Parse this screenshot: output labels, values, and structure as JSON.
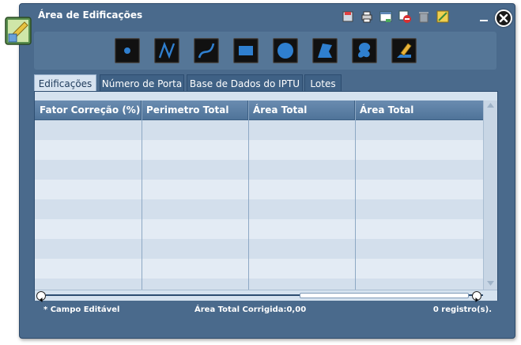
{
  "window": {
    "title": "Área de Edificações",
    "toolbar_icons": [
      "save-icon",
      "print-icon",
      "export-table-icon",
      "remove-layer-icon",
      "trash-icon",
      "measure-icon"
    ]
  },
  "draw_tools": [
    {
      "name": "point-tool",
      "icon": "point-icon"
    },
    {
      "name": "polyline-tool",
      "icon": "polyline-icon"
    },
    {
      "name": "curve-tool",
      "icon": "curve-icon"
    },
    {
      "name": "rectangle-tool",
      "icon": "rectangle-icon"
    },
    {
      "name": "circle-tool",
      "icon": "circle-icon"
    },
    {
      "name": "polygon-tool",
      "icon": "polygon-icon"
    },
    {
      "name": "freehand-polygon-tool",
      "icon": "freehand-shape-icon"
    },
    {
      "name": "edit-tool",
      "icon": "pencil-icon"
    }
  ],
  "tabs": [
    {
      "label": "Edificações",
      "active": true
    },
    {
      "label": "Número de Porta",
      "active": false
    },
    {
      "label": "Base de Dados do IPTU",
      "active": false
    },
    {
      "label": "Lotes",
      "active": false
    }
  ],
  "grid": {
    "columns": [
      "Fator Correção (%) *",
      "Perimetro Total",
      "Área Total Corrigida",
      "Área Total"
    ],
    "rows": []
  },
  "footer": {
    "editable_note": "* Campo Editável",
    "total_label": "Área Total Corrigida:0,00",
    "record_count": "0 registro(s)."
  },
  "colors": {
    "window_bg": "#4a6a8c",
    "header_bg": "#5b7ea4",
    "grid_bg": "#d5e2ef"
  }
}
